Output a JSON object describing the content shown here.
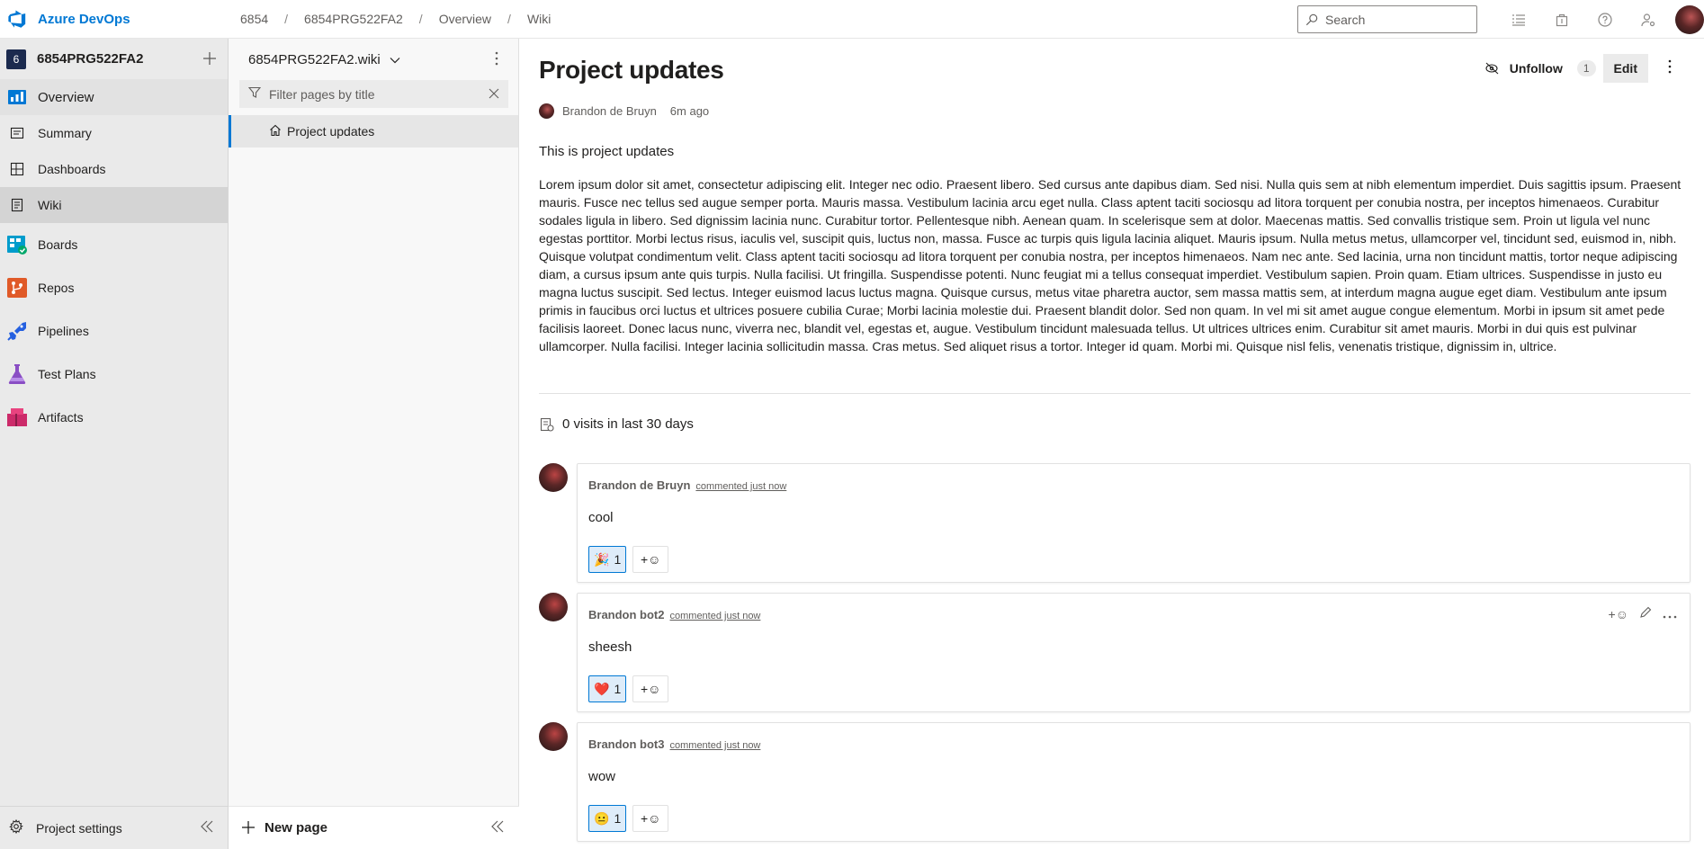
{
  "app": {
    "brand": "Azure DevOps"
  },
  "breadcrumb": [
    "6854",
    "6854PRG522FA2",
    "Overview",
    "Wiki"
  ],
  "search": {
    "placeholder": "Search"
  },
  "project": {
    "badge": "6",
    "name": "6854PRG522FA2"
  },
  "nav": {
    "items": [
      {
        "label": "Overview"
      },
      {
        "label": "Summary"
      },
      {
        "label": "Dashboards"
      },
      {
        "label": "Wiki"
      },
      {
        "label": "Boards"
      },
      {
        "label": "Repos"
      },
      {
        "label": "Pipelines"
      },
      {
        "label": "Test Plans"
      },
      {
        "label": "Artifacts"
      }
    ],
    "settings": "Project settings"
  },
  "wiki": {
    "name": "6854PRG522FA2.wiki",
    "filter_placeholder": "Filter pages by title",
    "pages": [
      {
        "title": "Project updates"
      }
    ],
    "new_page": "New page"
  },
  "page": {
    "title": "Project updates",
    "unfollow": "Unfollow",
    "followers": "1",
    "edit": "Edit",
    "author": "Brandon de Bruyn",
    "time": "6m ago",
    "intro": "This is project updates",
    "body": "Lorem ipsum dolor sit amet, consectetur adipiscing elit. Integer nec odio. Praesent libero. Sed cursus ante dapibus diam. Sed nisi. Nulla quis sem at nibh elementum imperdiet. Duis sagittis ipsum. Praesent mauris. Fusce nec tellus sed augue semper porta. Mauris massa. Vestibulum lacinia arcu eget nulla. Class aptent taciti sociosqu ad litora torquent per conubia nostra, per inceptos himenaeos. Curabitur sodales ligula in libero. Sed dignissim lacinia nunc. Curabitur tortor. Pellentesque nibh. Aenean quam. In scelerisque sem at dolor. Maecenas mattis. Sed convallis tristique sem. Proin ut ligula vel nunc egestas porttitor. Morbi lectus risus, iaculis vel, suscipit quis, luctus non, massa. Fusce ac turpis quis ligula lacinia aliquet. Mauris ipsum. Nulla metus metus, ullamcorper vel, tincidunt sed, euismod in, nibh. Quisque volutpat condimentum velit. Class aptent taciti sociosqu ad litora torquent per conubia nostra, per inceptos himenaeos. Nam nec ante. Sed lacinia, urna non tincidunt mattis, tortor neque adipiscing diam, a cursus ipsum ante quis turpis. Nulla facilisi. Ut fringilla. Suspendisse potenti. Nunc feugiat mi a tellus consequat imperdiet. Vestibulum sapien. Proin quam. Etiam ultrices. Suspendisse in justo eu magna luctus suscipit. Sed lectus. Integer euismod lacus luctus magna. Quisque cursus, metus vitae pharetra auctor, sem massa mattis sem, at interdum magna augue eget diam. Vestibulum ante ipsum primis in faucibus orci luctus et ultrices posuere cubilia Curae; Morbi lacinia molestie dui. Praesent blandit dolor. Sed non quam. In vel mi sit amet augue congue elementum. Morbi in ipsum sit amet pede facilisis laoreet. Donec lacus nunc, viverra nec, blandit vel, egestas et, augue. Vestibulum tincidunt malesuada tellus. Ut ultrices ultrices enim. Curabitur sit amet mauris. Morbi in dui quis est pulvinar ullamcorper. Nulla facilisi. Integer lacinia sollicitudin massa. Cras metus. Sed aliquet risus a tortor. Integer id quam. Morbi mi. Quisque nisl felis, venenatis tristique, dignissim in, ultrice.",
    "visits": "0 visits in last 30 days"
  },
  "comments": [
    {
      "author": "Brandon de Bruyn",
      "time": "commented just now",
      "text": "cool",
      "reaction_emoji": "🎉",
      "reaction_count": "1",
      "add_reaction": "+☺"
    },
    {
      "author": "Brandon bot2",
      "time": "commented just now",
      "text": "sheesh",
      "reaction_emoji": "❤️",
      "reaction_count": "1",
      "add_reaction": "+☺"
    },
    {
      "author": "Brandon bot3",
      "time": "commented just now",
      "text": "wow",
      "reaction_emoji": "😐",
      "reaction_count": "1",
      "add_reaction": "+☺"
    }
  ],
  "colors": {
    "accent": "#0078d4",
    "nav_bg": "#eaeaea",
    "reaction_bg": "#deecf9"
  }
}
